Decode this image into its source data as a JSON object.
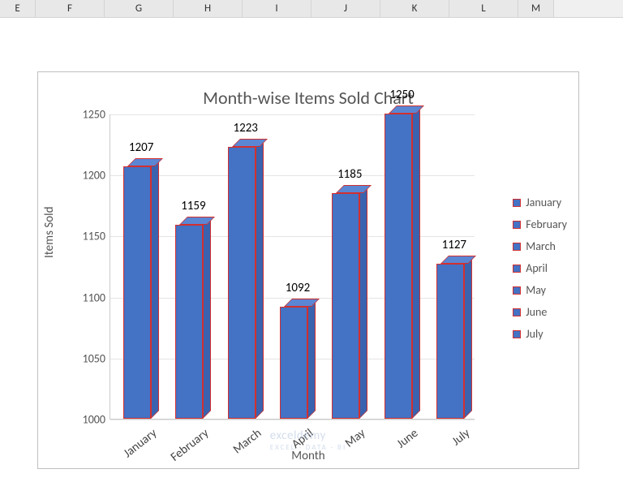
{
  "columns": [
    "E",
    "F",
    "G",
    "H",
    "I",
    "J",
    "K",
    "L",
    "M"
  ],
  "chart_data": {
    "type": "bar",
    "title": "Month-wise Items Sold Chart",
    "xlabel": "Month",
    "ylabel": "Items Sold",
    "ylim": [
      1000,
      1250
    ],
    "yticks": [
      1000,
      1050,
      1100,
      1150,
      1200,
      1250
    ],
    "categories": [
      "January",
      "February",
      "March",
      "April",
      "May",
      "June",
      "July"
    ],
    "values": [
      1207,
      1159,
      1223,
      1092,
      1185,
      1250,
      1127
    ],
    "legend": [
      "January",
      "February",
      "March",
      "April",
      "May",
      "June",
      "July"
    ],
    "bar_color": "#4472c4",
    "edge_color": "#d32f2f"
  },
  "watermark": {
    "brand": "exceldemy",
    "tag": "EXCEL · DATA · BI"
  }
}
